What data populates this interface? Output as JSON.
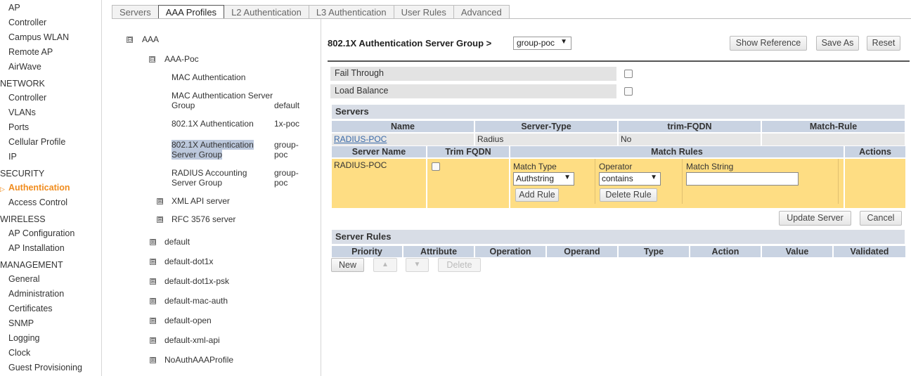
{
  "nav": {
    "items_top": [
      "AP",
      "Controller",
      "Campus WLAN",
      "Remote AP",
      "AirWave"
    ],
    "network": {
      "title": "NETWORK",
      "items": [
        "Controller",
        "VLANs",
        "Ports",
        "Cellular Profile",
        "IP"
      ]
    },
    "security": {
      "title": "SECURITY",
      "items": [
        "Authentication",
        "Access Control"
      ]
    },
    "wireless": {
      "title": "WIRELESS",
      "items": [
        "AP Configuration",
        "AP Installation"
      ]
    },
    "management": {
      "title": "MANAGEMENT",
      "items": [
        "General",
        "Administration",
        "Certificates",
        "SNMP",
        "Logging",
        "Clock",
        "Guest Provisioning"
      ]
    }
  },
  "tabs": [
    "Servers",
    "AAA Profiles",
    "L2 Authentication",
    "L3 Authentication",
    "User Rules",
    "Advanced"
  ],
  "tree": {
    "root": "AAA",
    "profile": "AAA-Poc",
    "children": [
      {
        "label": "MAC Authentication",
        "value": ""
      },
      {
        "label_lines": [
          "MAC Authentication Server",
          "Group"
        ],
        "value": "default"
      },
      {
        "label": "802.1X Authentication",
        "value": "1x-poc"
      },
      {
        "label_lines": [
          "802.1X Authentication",
          "Server Group"
        ],
        "value_lines": [
          "group-",
          "poc"
        ]
      },
      {
        "label_lines": [
          "RADIUS Accounting",
          "Server Group"
        ],
        "value_lines": [
          "group-",
          "poc"
        ]
      }
    ],
    "sub_collapsed": [
      "XML API server",
      "RFC 3576 server"
    ],
    "profiles_collapsed": [
      "default",
      "default-dot1x",
      "default-dot1x-psk",
      "default-mac-auth",
      "default-open",
      "default-xml-api",
      "NoAuthAAAProfile"
    ],
    "toggle_expanded": "⊟",
    "toggle_collapsed": "⊞"
  },
  "panel": {
    "title": "802.1X Authentication Server Group >",
    "group_select": "group-poc",
    "buttons": {
      "show_reference": "Show Reference",
      "save_as": "Save As",
      "reset": "Reset"
    },
    "options": {
      "fail_through": "Fail Through",
      "load_balance": "Load Balance"
    },
    "servers": {
      "title": "Servers",
      "headers": [
        "Name",
        "Server-Type",
        "trim-FQDN",
        "Match-Rule"
      ],
      "row": {
        "name": "RADIUS-POC",
        "type": "Radius",
        "trim": "No",
        "match": ""
      },
      "edit_headers": [
        "Server Name",
        "Trim FQDN",
        "Match Rules",
        "Actions"
      ],
      "edit_row": {
        "server_name": "RADIUS-POC",
        "match_type_label": "Match Type",
        "match_type_value": "Authstring",
        "operator_label": "Operator",
        "operator_value": "contains",
        "match_string_label": "Match String",
        "match_string_value": "",
        "add_rule": "Add Rule",
        "delete_rule": "Delete Rule"
      },
      "update_server": "Update Server",
      "cancel": "Cancel"
    },
    "server_rules": {
      "title": "Server Rules",
      "headers": [
        "Priority",
        "Attribute",
        "Operation",
        "Operand",
        "Type",
        "Action",
        "Value",
        "Validated"
      ],
      "buttons": {
        "new": "New",
        "up": "▲",
        "down": "▼",
        "delete": "Delete"
      }
    }
  },
  "colors": {
    "accent": "#f08c1e",
    "header": "#c9d3e2",
    "edit_row": "#fedd83",
    "link": "#3a6aa8"
  }
}
